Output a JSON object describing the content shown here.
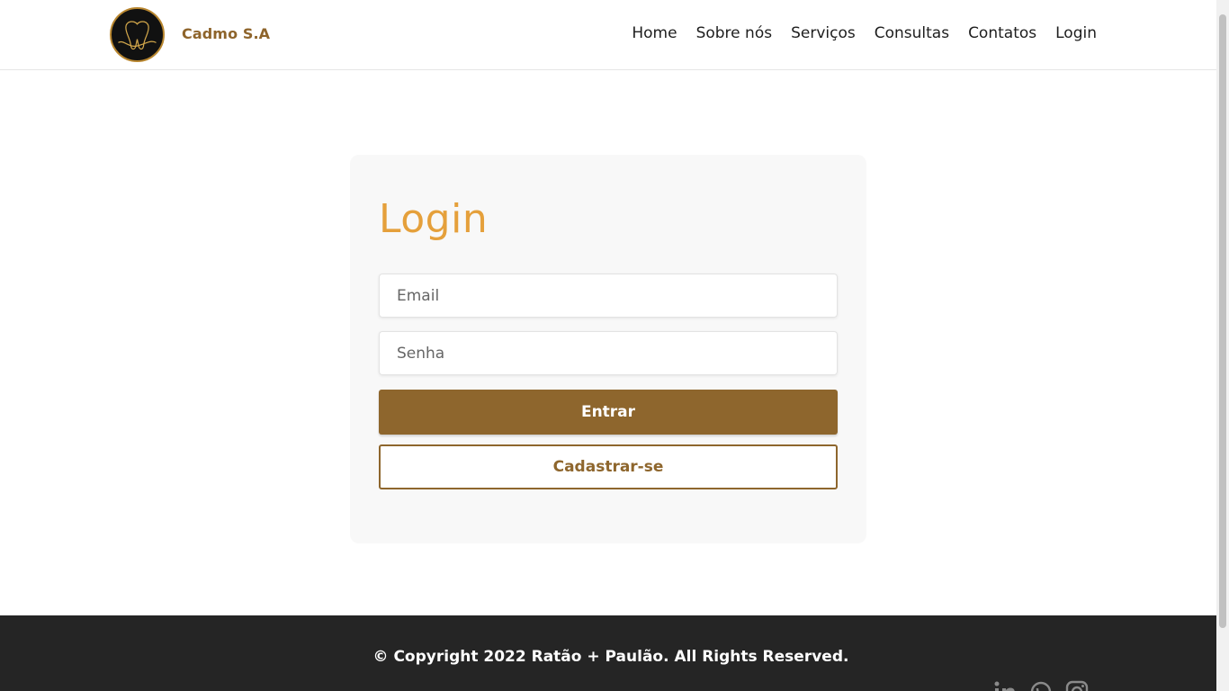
{
  "header": {
    "brand": "Cadmo S.A",
    "logo_icon": "tooth-logo-icon",
    "nav": [
      "Home",
      "Sobre nós",
      "Serviços",
      "Consultas",
      "Contatos",
      "Login"
    ]
  },
  "login": {
    "title": "Login",
    "email_placeholder": "Email",
    "password_placeholder": "Senha",
    "submit_label": "Entrar",
    "register_label": "Cadastrar-se"
  },
  "footer": {
    "copyright": "© Copyright 2022 Ratão + Paulão. All Rights Reserved.",
    "social_icons": [
      "linkedin-icon",
      "whatsapp-icon",
      "instagram-icon"
    ]
  },
  "colors": {
    "brand": "#8e662d",
    "title_accent": "#e5a03b",
    "footer_bg": "#252525"
  }
}
